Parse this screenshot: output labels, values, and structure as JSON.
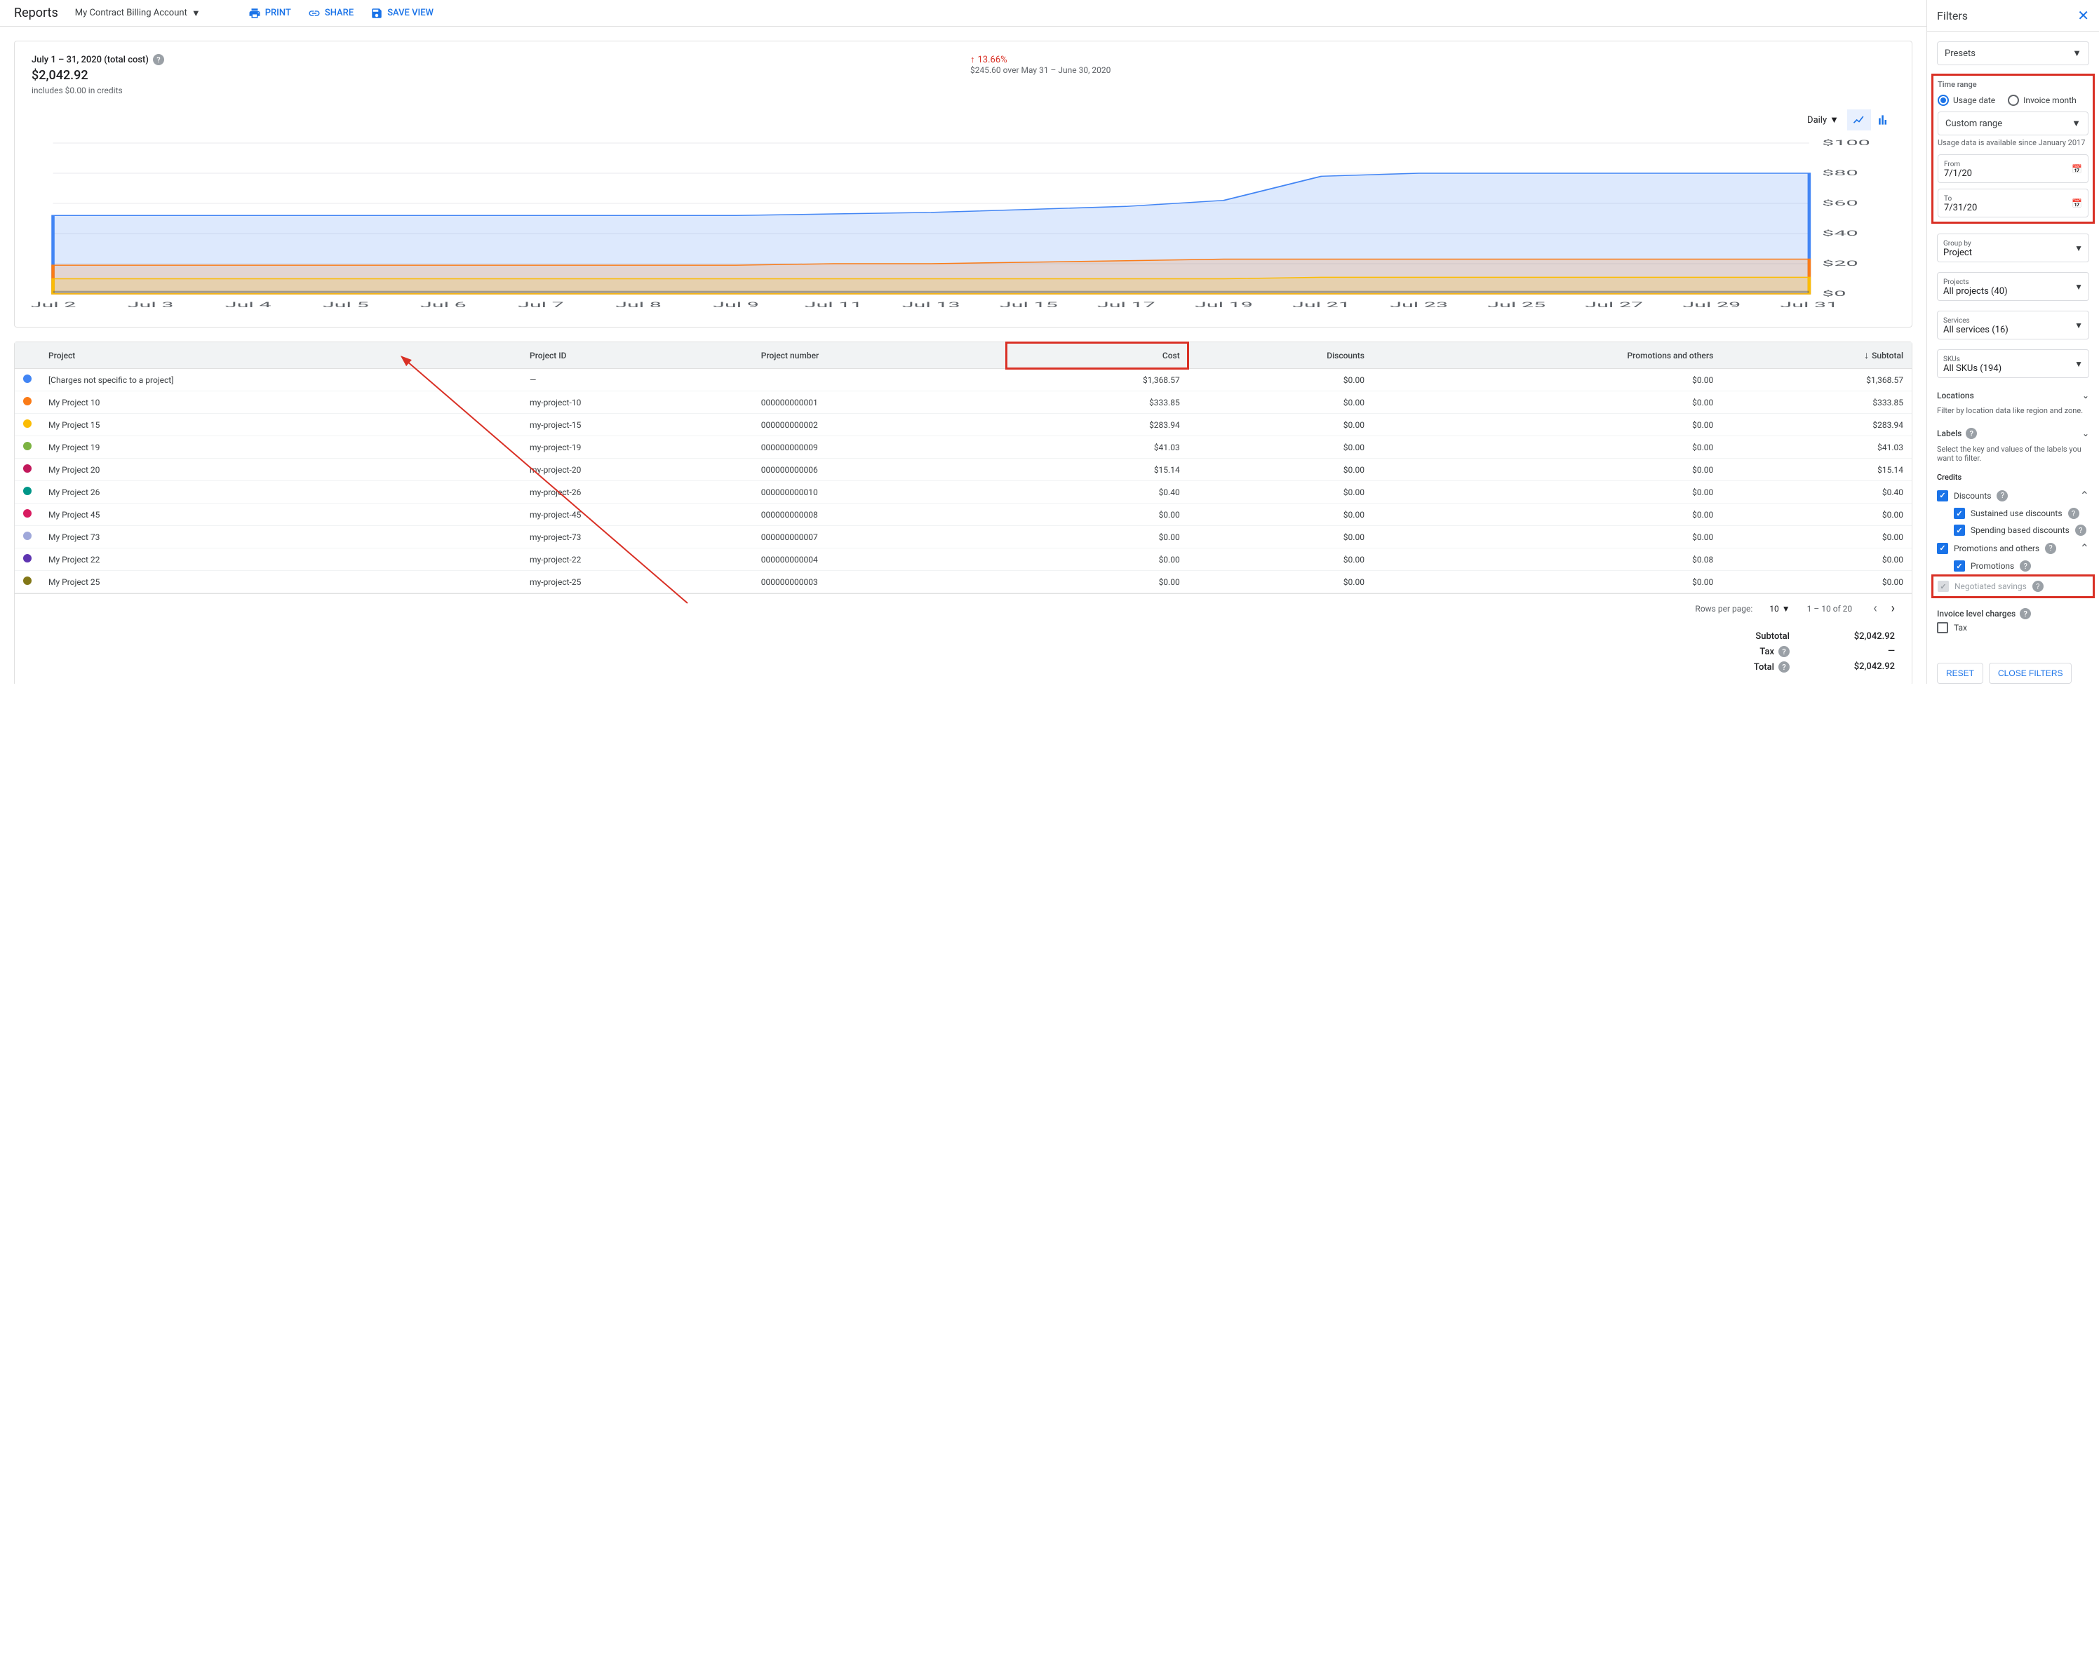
{
  "topbar": {
    "title": "Reports",
    "account": "My Contract Billing Account",
    "print": "PRINT",
    "share": "SHARE",
    "save": "SAVE VIEW"
  },
  "summary": {
    "period": "July 1 – 31, 2020 (total cost)",
    "total": "$2,042.92",
    "credits_note": "includes $0.00 in credits",
    "pct": "13.66%",
    "diff": "$245.60 over May 31 – June 30, 2020"
  },
  "chart_ctrl": {
    "daily": "Daily"
  },
  "chart_data": {
    "type": "area",
    "xlabel": "",
    "ylabel": "",
    "ylim": [
      0,
      100
    ],
    "yticks": [
      "$0",
      "$20",
      "$40",
      "$60",
      "$80",
      "$100"
    ],
    "x": [
      "Jul 2",
      "Jul 3",
      "Jul 4",
      "Jul 5",
      "Jul 6",
      "Jul 7",
      "Jul 8",
      "Jul 9",
      "Jul 11",
      "Jul 13",
      "Jul 15",
      "Jul 17",
      "Jul 19",
      "Jul 21",
      "Jul 23",
      "Jul 25",
      "Jul 27",
      "Jul 29",
      "Jul 31"
    ],
    "series": [
      {
        "name": "My Project 15",
        "color": "#fbbc04",
        "values": [
          10,
          10,
          10,
          10,
          10,
          10,
          10,
          10,
          10,
          10,
          10,
          10,
          10,
          11,
          11,
          11,
          11,
          11,
          11
        ]
      },
      {
        "name": "My Project 10",
        "color": "#fa7b17",
        "values": [
          19,
          19,
          19,
          19,
          19,
          19,
          19,
          19,
          20,
          20,
          21,
          22,
          23,
          23,
          23,
          23,
          23,
          23,
          23
        ]
      },
      {
        "name": "[Charges not specific to a project]",
        "color": "#4285f4",
        "values": [
          52,
          52,
          52,
          52,
          52,
          52,
          52,
          52,
          53,
          54,
          56,
          58,
          62,
          78,
          80,
          80,
          80,
          80,
          80
        ]
      }
    ]
  },
  "table": {
    "headers": {
      "project": "Project",
      "project_id": "Project ID",
      "project_num": "Project number",
      "cost": "Cost",
      "discounts": "Discounts",
      "promo": "Promotions and others",
      "subtotal": "Subtotal"
    },
    "rows": [
      {
        "color": "#4285f4",
        "project": "[Charges not specific to a project]",
        "id": "—",
        "num": "",
        "cost": "$1,368.57",
        "disc": "$0.00",
        "promo": "$0.00",
        "sub": "$1,368.57"
      },
      {
        "color": "#fa7b17",
        "project": "My Project 10",
        "id": "my-project-10",
        "num": "000000000001",
        "cost": "$333.85",
        "disc": "$0.00",
        "promo": "$0.00",
        "sub": "$333.85"
      },
      {
        "color": "#fbbc04",
        "project": "My Project 15",
        "id": "my-project-15",
        "num": "000000000002",
        "cost": "$283.94",
        "disc": "$0.00",
        "promo": "$0.00",
        "sub": "$283.94"
      },
      {
        "color": "#7cb342",
        "project": "My Project 19",
        "id": "my-project-19",
        "num": "000000000009",
        "cost": "$41.03",
        "disc": "$0.00",
        "promo": "$0.00",
        "sub": "$41.03"
      },
      {
        "color": "#c2185b",
        "project": "My Project 20",
        "id": "my-project-20",
        "num": "000000000006",
        "cost": "$15.14",
        "disc": "$0.00",
        "promo": "$0.00",
        "sub": "$15.14"
      },
      {
        "color": "#009688",
        "project": "My Project 26",
        "id": "my-project-26",
        "num": "000000000010",
        "cost": "$0.40",
        "disc": "$0.00",
        "promo": "$0.00",
        "sub": "$0.40"
      },
      {
        "color": "#d81b60",
        "project": "My Project 45",
        "id": "my-project-45",
        "num": "000000000008",
        "cost": "$0.00",
        "disc": "$0.00",
        "promo": "$0.00",
        "sub": "$0.00"
      },
      {
        "color": "#9fa8da",
        "project": "My Project 73",
        "id": "my-project-73",
        "num": "000000000007",
        "cost": "$0.00",
        "disc": "$0.00",
        "promo": "$0.00",
        "sub": "$0.00"
      },
      {
        "color": "#5e35b1",
        "project": "My Project 22",
        "id": "my-project-22",
        "num": "000000000004",
        "cost": "$0.00",
        "disc": "$0.00",
        "promo": "$0.08",
        "sub": "$0.00"
      },
      {
        "color": "#827717",
        "project": "My Project 25",
        "id": "my-project-25",
        "num": "000000000003",
        "cost": "$0.00",
        "disc": "$0.00",
        "promo": "$0.00",
        "sub": "$0.00"
      }
    ]
  },
  "pager": {
    "rpp_label": "Rows per page:",
    "rpp": "10",
    "range": "1 – 10 of 20"
  },
  "totals": {
    "subtotal_l": "Subtotal",
    "subtotal_v": "$2,042.92",
    "tax_l": "Tax",
    "tax_v": "—",
    "total_l": "Total",
    "total_v": "$2,042.92"
  },
  "filters": {
    "title": "Filters",
    "presets": "Presets",
    "time_range": "Time range",
    "usage_date": "Usage date",
    "invoice_month": "Invoice month",
    "custom_range": "Custom range",
    "avail_note": "Usage data is available since January 2017",
    "from_l": "From",
    "from_v": "7/1/20",
    "to_l": "To",
    "to_v": "7/31/20",
    "group_by_l": "Group by",
    "group_by_v": "Project",
    "projects_l": "Projects",
    "projects_v": "All projects (40)",
    "services_l": "Services",
    "services_v": "All services (16)",
    "skus_l": "SKUs",
    "skus_v": "All SKUs (194)",
    "locations": "Locations",
    "locations_note": "Filter by location data like region and zone.",
    "labels": "Labels",
    "labels_note": "Select the key and values of the labels you want to filter.",
    "credits": "Credits",
    "discounts": "Discounts",
    "sustained": "Sustained use discounts",
    "spending": "Spending based discounts",
    "promos": "Promotions and others",
    "promotions": "Promotions",
    "negotiated": "Negotiated savings",
    "invoice_charges": "Invoice level charges",
    "tax": "Tax",
    "reset": "RESET",
    "close": "CLOSE FILTERS"
  }
}
